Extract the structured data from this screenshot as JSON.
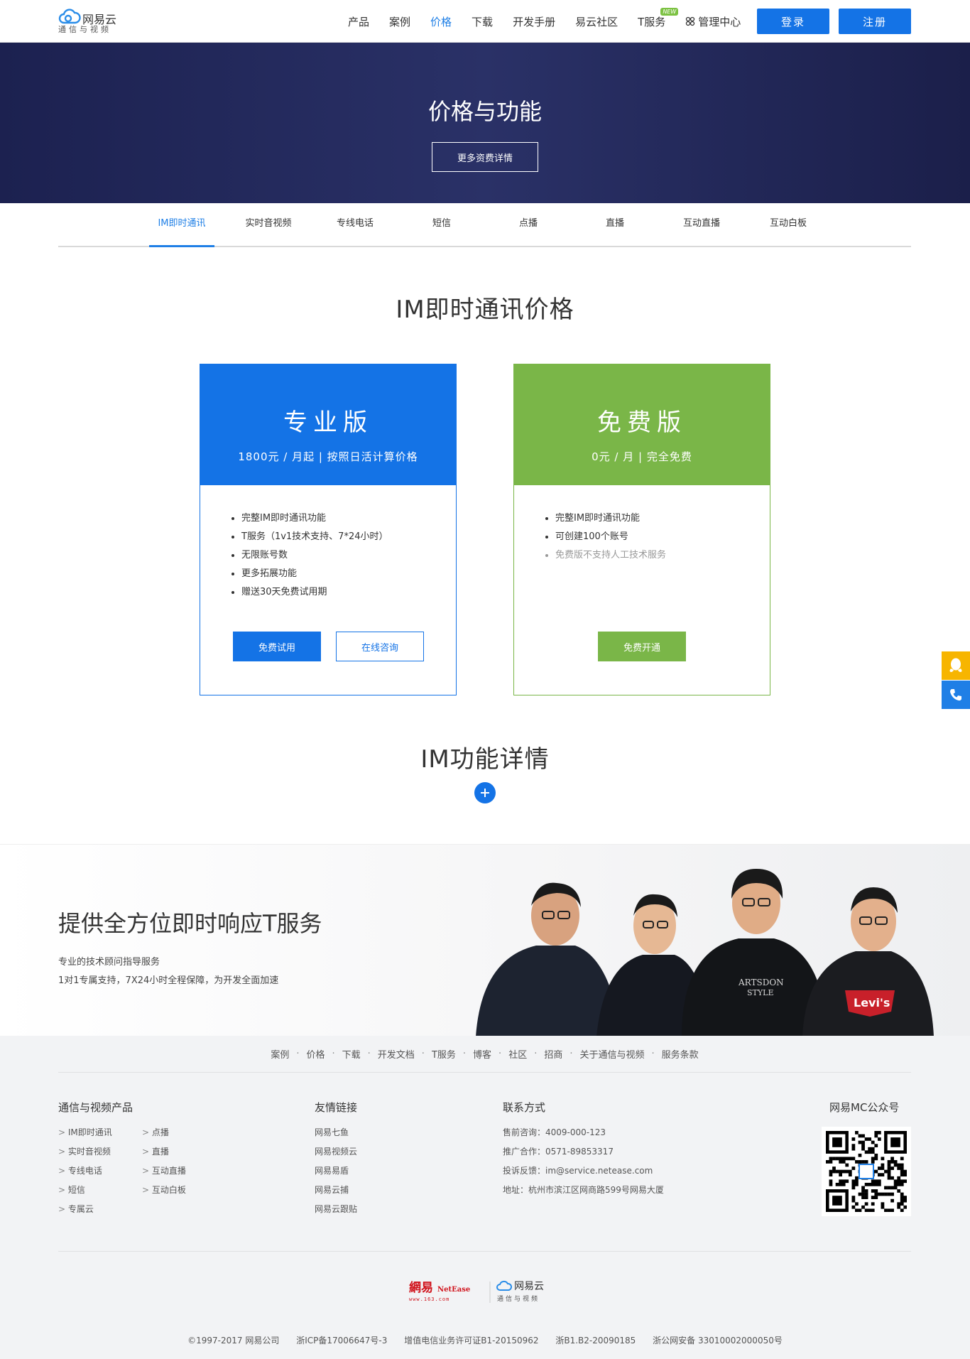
{
  "header": {
    "logo_name": "网易云",
    "logo_sub": "通信与视频",
    "nav": [
      {
        "label": "产品"
      },
      {
        "label": "案例"
      },
      {
        "label": "价格"
      },
      {
        "label": "下载"
      },
      {
        "label": "开发手册"
      },
      {
        "label": "易云社区"
      },
      {
        "label": "T服务",
        "badge": "NEW"
      },
      {
        "label": "管理中心"
      }
    ],
    "active_nav": "价格",
    "login": "登录",
    "register": "注册",
    "brand_color": "#1473e6"
  },
  "banner": {
    "title": "价格与功能",
    "button": "更多资费详情"
  },
  "tabs": [
    "IM即时通讯",
    "实时音视频",
    "专线电话",
    "短信",
    "点播",
    "直播",
    "互动直播",
    "互动白板"
  ],
  "active_tab": "IM即时通讯",
  "pricing": {
    "title": "IM即时通讯价格",
    "pro": {
      "name": "专业版",
      "price": "1800元 / 月起 | 按照日活计算价格",
      "features": [
        "完整IM即时通讯功能",
        "T服务（1v1技术支持、7*24小时）",
        "无限账号数",
        "更多拓展功能",
        "赠送30天免费试用期"
      ],
      "btn_trial": "免费试用",
      "btn_consult": "在线咨询",
      "color": "#1473e6"
    },
    "free": {
      "name": "免费版",
      "price": "0元 / 月 | 完全免费",
      "features": [
        "完整IM即时通讯功能",
        "可创建100个账号"
      ],
      "note": "免费版不支持人工技术服务",
      "btn_open": "免费开通",
      "color": "#7ab648"
    }
  },
  "details": {
    "title": "IM功能详情",
    "expand_icon": "plus-icon"
  },
  "tservice": {
    "title": "提供全方位即时响应T服务",
    "line1": "专业的技术顾问指导服务",
    "line2": "1对1专属支持，7X24小时全程保障，为开发全面加速",
    "shirt_text1": "ARTSDON",
    "shirt_text2": "STYLE",
    "shirt_logo": "Levi's"
  },
  "footer": {
    "links": [
      "案例",
      "价格",
      "下载",
      "开发文档",
      "T服务",
      "博客",
      "社区",
      "招商",
      "关于通信与视频",
      "服务条款"
    ],
    "products_title": "通信与视频产品",
    "products": [
      "IM即时通讯",
      "点播",
      "实时音视频",
      "直播",
      "专线电话",
      "互动直播",
      "短信",
      "互动白板",
      "专属云"
    ],
    "friends_title": "友情链接",
    "friends": [
      "网易七鱼",
      "网易视频云",
      "网易易盾",
      "网易云捕",
      "网易云跟贴"
    ],
    "contact_title": "联系方式",
    "contact": [
      "售前咨询：4009-000-123",
      "推广合作：0571-89853317",
      "投诉反馈：im@service.netease.com",
      "地址：杭州市滨江区网商路599号网易大厦"
    ],
    "qr_title": "网易MC公众号",
    "logo_netease": "網易",
    "logo_netease_en": "NetEase",
    "logo_netease_url": "www.163.com",
    "logo_yun": "网易云",
    "logo_yun_sub": "通信与视频",
    "copyright": [
      "©1997-2017 网易公司",
      "浙ICP备17006647号-3",
      "增值电信业务许可证B1-20150962",
      "浙B1.B2-20090185",
      "浙公网安备 33010002000050号"
    ]
  }
}
